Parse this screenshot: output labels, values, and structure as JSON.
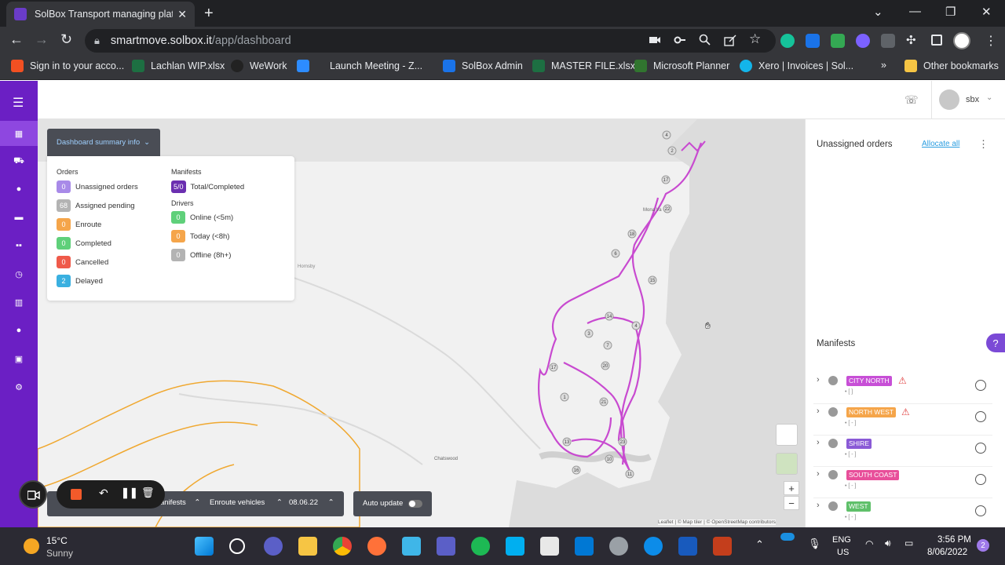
{
  "browser": {
    "tab_title": "SolBox Transport managing platf",
    "url_host": "smartmove.solbox.it",
    "url_path": "/app/dashboard",
    "bookmarks": [
      {
        "label": "Sign in to your acco...",
        "color": "#f25022"
      },
      {
        "label": "Lachlan WIP.xlsx",
        "color": "#1d6f42"
      },
      {
        "label": "WeWork",
        "color": "#222222"
      },
      {
        "label": "Launch Meeting - Z...",
        "color": "#2d8cff"
      },
      {
        "label": "SolBox Admin",
        "color": "#1a73e8"
      },
      {
        "label": "MASTER FILE.xlsx",
        "color": "#1d6f42"
      },
      {
        "label": "Microsoft Planner",
        "color": "#31752f"
      },
      {
        "label": "Xero | Invoices | Sol...",
        "color": "#13b5ea"
      }
    ],
    "other_bookmarks": "Other bookmarks"
  },
  "app": {
    "user": "sbx",
    "dashboard_button": "Dashboard summary info",
    "orders_heading": "Orders",
    "orders": [
      {
        "count": "0",
        "label": "Unassigned orders",
        "color": "#a88ae8"
      },
      {
        "count": "68",
        "label": "Assigned pending",
        "color": "#b3b3b3"
      },
      {
        "count": "0",
        "label": "Enroute",
        "color": "#f5a54a"
      },
      {
        "count": "0",
        "label": "Completed",
        "color": "#5fd07a"
      },
      {
        "count": "0",
        "label": "Cancelled",
        "color": "#ef5a4a"
      },
      {
        "count": "2",
        "label": "Delayed",
        "color": "#3ab0e0"
      }
    ],
    "manifests_heading": "Manifests",
    "manifest_summary": {
      "count": "5/0",
      "label": "Total/Completed",
      "color": "#6b2fb0"
    },
    "drivers_heading": "Drivers",
    "drivers": [
      {
        "count": "0",
        "label": "Online (<5m)",
        "color": "#5fd07a"
      },
      {
        "count": "0",
        "label": "Today (<8h)",
        "color": "#f5a54a"
      },
      {
        "count": "0",
        "label": "Offline (8h+)",
        "color": "#b3b3b3"
      }
    ],
    "bottom_bar": {
      "manifests": "anifests",
      "enroute": "Enroute vehicles",
      "date": "08.06.22",
      "auto_update": "Auto update"
    },
    "map_labels": {
      "hornsby": "Hornsby",
      "chatswood": "Chatswood",
      "mona_vale": "Mona Va",
      "attribution": "Leaflet | © Map tiler | © OpenStreetMap contributors"
    },
    "route_stops": [
      "4",
      "2",
      "17",
      "22",
      "18",
      "6",
      "15",
      "14",
      "4",
      "3",
      "7",
      "20",
      "17",
      "1",
      "21",
      "13",
      "23",
      "16",
      "10",
      "11"
    ],
    "right_panel": {
      "unassigned_title": "Unassigned orders",
      "allocate_all": "Allocate all",
      "manifests_title": "Manifests",
      "manifests": [
        {
          "name": "CITY NORTH",
          "color": "#c74fd6",
          "warning": true,
          "sub": "• [ ]"
        },
        {
          "name": "NORTH WEST",
          "color": "#f5a54a",
          "warning": true,
          "sub": "• [ - ]"
        },
        {
          "name": "SHIRE",
          "color": "#8a5ad6",
          "warning": false,
          "sub": "• [ - ]"
        },
        {
          "name": "SOUTH COAST",
          "color": "#e84f9a",
          "warning": false,
          "sub": "• [ - ]"
        },
        {
          "name": "WEST",
          "color": "#5fc06a",
          "warning": false,
          "sub": "• [ - ]"
        }
      ]
    }
  },
  "taskbar": {
    "weather_temp": "15°C",
    "weather_desc": "Sunny",
    "lang": "ENG",
    "region": "US",
    "time": "3:56 PM",
    "date": "8/06/2022",
    "notif_count": "2"
  }
}
